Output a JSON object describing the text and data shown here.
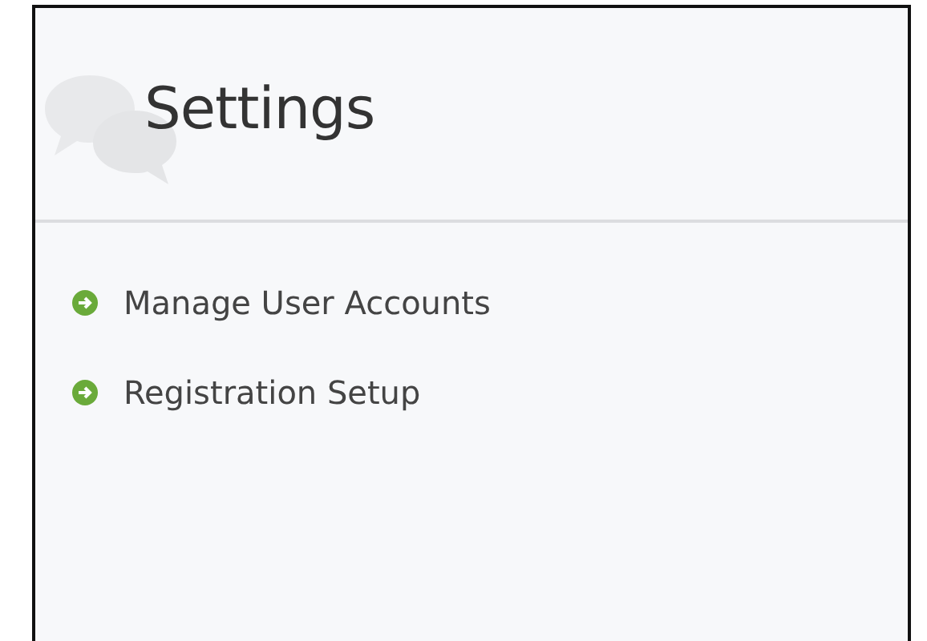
{
  "panel": {
    "title": "Settings"
  },
  "links": [
    {
      "label": "Manage User Accounts"
    },
    {
      "label": "Registration Setup"
    }
  ]
}
